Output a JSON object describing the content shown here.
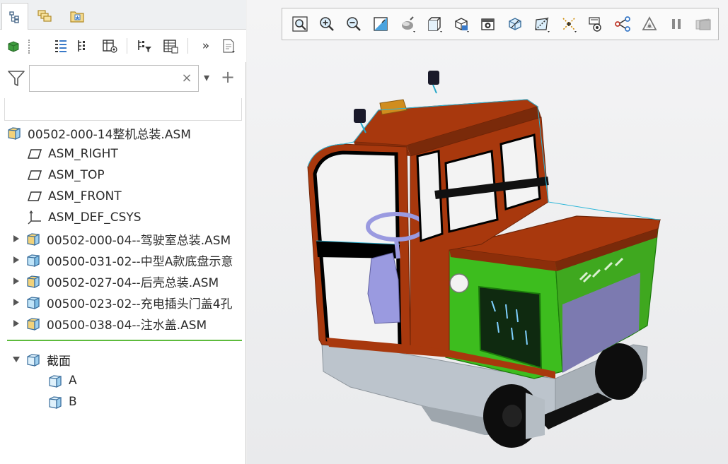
{
  "panel_tabs": [
    {
      "name": "model-tree-icon"
    },
    {
      "name": "layers-icon"
    },
    {
      "name": "favorites-icon"
    }
  ],
  "tree_toolbar": {
    "more_label": "»"
  },
  "filter": {
    "search_value": "",
    "clear_label": "×",
    "dropdown_label": "▾",
    "add_label": "+"
  },
  "model_tree": {
    "root": "00502-000-14整机总装.ASM",
    "items": [
      {
        "label": "ASM_RIGHT",
        "icon": "datum-plane-icon"
      },
      {
        "label": "ASM_TOP",
        "icon": "datum-plane-icon"
      },
      {
        "label": "ASM_FRONT",
        "icon": "datum-plane-icon"
      },
      {
        "label": "ASM_DEF_CSYS",
        "icon": "coordinate-system-icon"
      },
      {
        "label": "00502-000-04--驾驶室总装.ASM",
        "icon": "assembly-icon"
      },
      {
        "label": "00500-031-02--中型A款底盘示意",
        "icon": "part-icon"
      },
      {
        "label": "00502-027-04--后壳总装.ASM",
        "icon": "assembly-icon"
      },
      {
        "label": "00500-023-02--充电插头门盖4孔",
        "icon": "part-icon"
      },
      {
        "label": "00500-038-04--注水盖.ASM",
        "icon": "assembly-icon"
      }
    ]
  },
  "section_tree": {
    "folder": "截面",
    "items": [
      "A",
      "B"
    ]
  },
  "view_toolbar": {
    "buttons": [
      "refit-icon",
      "zoom-in-icon",
      "zoom-out-icon",
      "repaint-icon",
      "display-style-icon",
      "saved-orientations-icon",
      "named-views-icon",
      "perspective-view-icon",
      "section-icon",
      "annotation-display-icon",
      "datum-display-icon",
      "spin-center-icon",
      "view-manager-icon",
      "appearance-icon",
      "pause-icon",
      "render-icon"
    ]
  },
  "colors": {
    "accent_green": "#5dbb3c",
    "cab_orange": "#a8380d",
    "body_green": "#3dbd1e"
  }
}
